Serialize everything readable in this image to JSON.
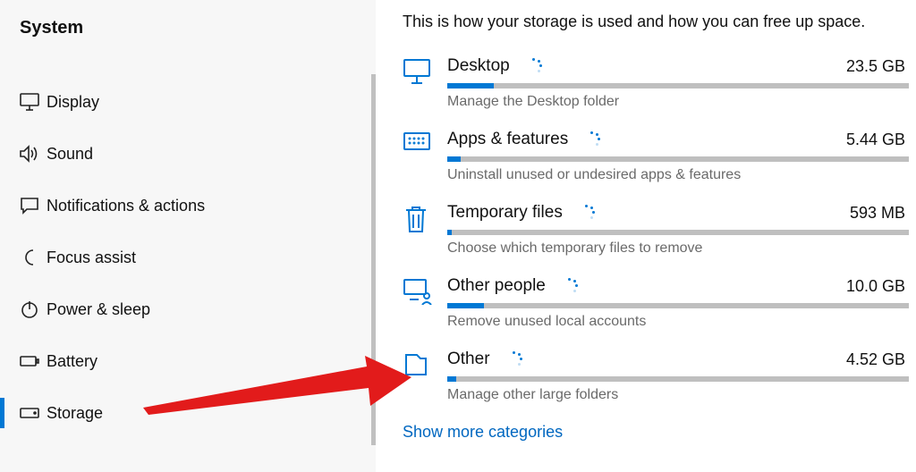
{
  "sidebar": {
    "title": "System",
    "items": [
      {
        "label": "Display"
      },
      {
        "label": "Sound"
      },
      {
        "label": "Notifications & actions"
      },
      {
        "label": "Focus assist"
      },
      {
        "label": "Power & sleep"
      },
      {
        "label": "Battery"
      },
      {
        "label": "Storage"
      }
    ]
  },
  "main": {
    "intro": "This is how your storage is used and how you can free up space.",
    "categories": [
      {
        "title": "Desktop",
        "size": "23.5 GB",
        "desc": "Manage the Desktop folder",
        "fill_pct": 10
      },
      {
        "title": "Apps & features",
        "size": "5.44 GB",
        "desc": "Uninstall unused or undesired apps & features",
        "fill_pct": 3
      },
      {
        "title": "Temporary files",
        "size": "593 MB",
        "desc": "Choose which temporary files to remove",
        "fill_pct": 1
      },
      {
        "title": "Other people",
        "size": "10.0 GB",
        "desc": "Remove unused local accounts",
        "fill_pct": 8
      },
      {
        "title": "Other",
        "size": "4.52 GB",
        "desc": "Manage other large folders",
        "fill_pct": 2
      }
    ],
    "show_more": "Show more categories"
  }
}
